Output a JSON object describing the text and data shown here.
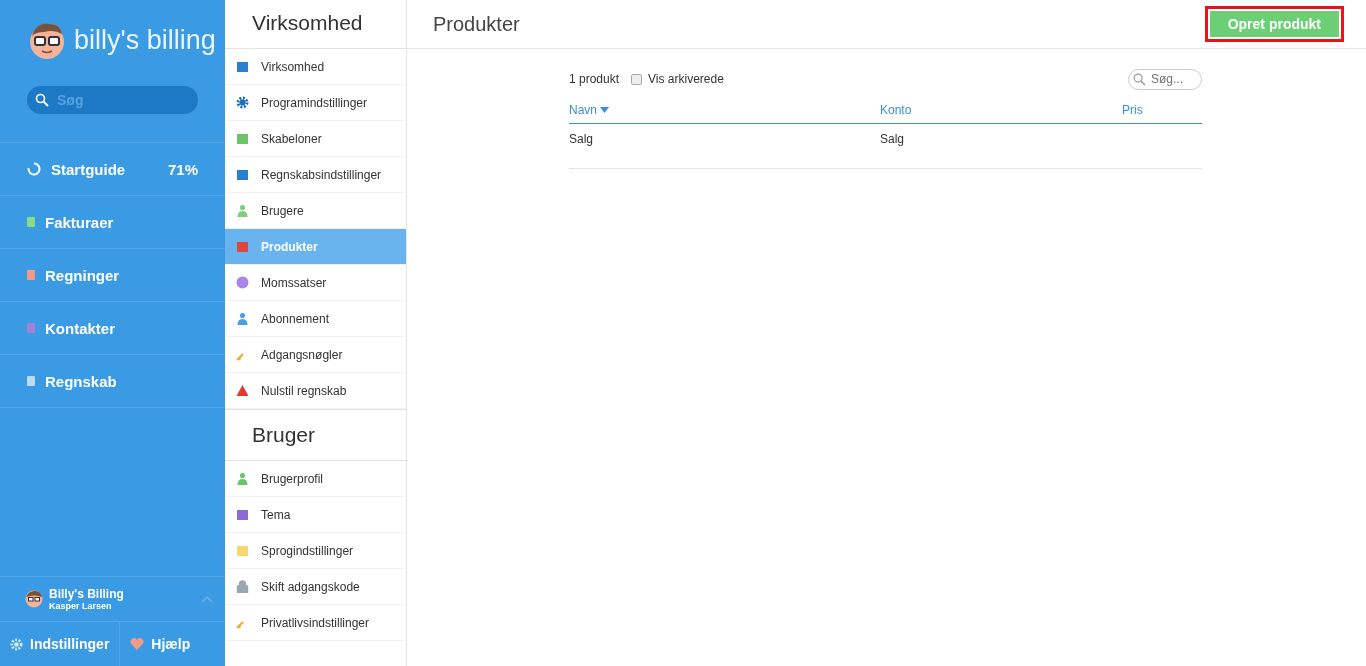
{
  "sidebar": {
    "logo_text": "billy's billing",
    "search": {
      "placeholder": "Søg"
    },
    "items": [
      {
        "label": "Startguide",
        "value": "71%"
      },
      {
        "label": "Fakturaer"
      },
      {
        "label": "Regninger"
      },
      {
        "label": "Kontakter"
      },
      {
        "label": "Regnskab"
      }
    ],
    "account": {
      "company": "Billy's Billing",
      "user": "Kasper Larsen"
    },
    "footer": [
      "Indstillinger",
      "Hjælp"
    ]
  },
  "settings": {
    "sections": [
      {
        "title": "Virksomhed",
        "items": [
          {
            "label": "Virksomhed",
            "selected": false
          },
          {
            "label": "Programindstillinger",
            "selected": false
          },
          {
            "label": "Skabeloner",
            "selected": false
          },
          {
            "label": "Regnskabsindstillinger",
            "selected": false
          },
          {
            "label": "Brugere",
            "selected": false
          },
          {
            "label": "Produkter",
            "selected": true
          },
          {
            "label": "Momssatser",
            "selected": false
          },
          {
            "label": "Abonnement",
            "selected": false
          },
          {
            "label": "Adgangsnøgler",
            "selected": false
          },
          {
            "label": "Nulstil regnskab",
            "selected": false
          }
        ]
      },
      {
        "title": "Bruger",
        "items": [
          {
            "label": "Brugerprofil",
            "selected": false
          },
          {
            "label": "Tema",
            "selected": false
          },
          {
            "label": "Sprogindstillinger",
            "selected": false
          },
          {
            "label": "Skift adgangskode",
            "selected": false
          },
          {
            "label": "Privatlivsindstillinger",
            "selected": false
          }
        ]
      }
    ]
  },
  "main": {
    "title": "Produkter",
    "create_button": "Opret produkt",
    "count": "1 produkt",
    "show_archived": {
      "label": "Vis arkiverede",
      "checked": false
    },
    "search": {
      "placeholder": "Søg..."
    },
    "table": {
      "columns": [
        "Navn",
        "Konto",
        "Pris"
      ],
      "rows": [
        [
          "Salg",
          "Salg",
          ""
        ]
      ]
    }
  }
}
